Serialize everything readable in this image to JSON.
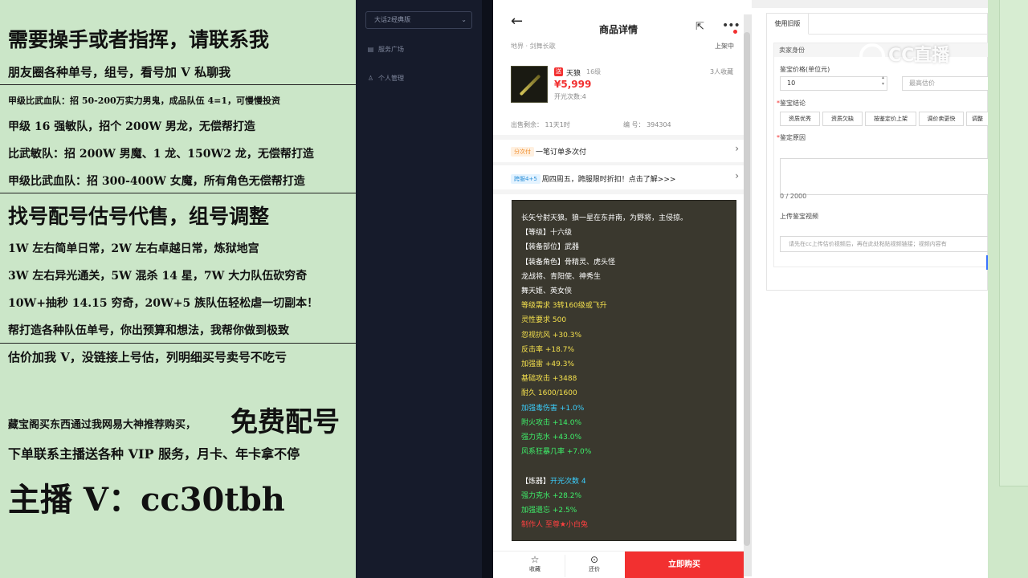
{
  "promo": {
    "lines": [
      "需要操手或者指挥，请联系我",
      "朋友圈各种单号，组号，看号加 V 私聊我",
      "甲级比武血队：招 50-200万实力男鬼，成品队伍 4=1，可慢慢投资",
      "甲级 16 强敏队，招个 200W 男龙，无偿帮打造",
      "比武敏队：招 200W 男魔、1 龙、150W2 龙，无偿帮打造",
      "甲级比武血队：招 300-400W 女魔，所有角色无偿帮打造",
      "找号配号估号代售，组号调整",
      "1W 左右简单日常，2W 左右卓越日常，炼狱地宫",
      "3W 左右异光通关，5W 混杀 14 星，7W 大力队伍砍穷奇",
      "10W+抽秒 14.15 穷奇，20W+5 族队伍轻松虐一切副本！",
      "帮打造各种队伍单号，你出预算和想法，我帮你做到极致",
      "估价加我 V，没链接上号估，列明细买号卖号不吃亏",
      "藏宝阁买东西通过我网易大神推荐购买，",
      "免费配号",
      "下单联系主播送各种 VIP 服务，月卡、年卡拿不停",
      "主播 V：cc30tbh"
    ]
  },
  "nav": {
    "select_label": "大话2经典版",
    "items": [
      "服务广场",
      "个人管理"
    ],
    "icons": [
      "doc-icon",
      "user-icon"
    ]
  },
  "phone": {
    "title": "商品详情",
    "realm": "地界 · 剑舞长歌",
    "status": "上架中",
    "item": {
      "tag": "送",
      "name": "天狼",
      "level": "16级",
      "price": "¥5,999",
      "opens": "开光次数:4",
      "favorites": "3人收藏",
      "remaining": "出售剩余： 11天1时",
      "code": "编 号： 394304"
    },
    "promos": [
      {
        "badge": "分次付",
        "text": "一笔订单多次付",
        "badge_bg": "#fff0e0",
        "badge_fg": "#f08a24"
      },
      {
        "badge": "跨服4+5",
        "text": "周四周五，跨服限时折扣！点击了解>>>",
        "badge_bg": "#e4f3ff",
        "badge_fg": "#2a8fd8"
      }
    ],
    "stats": [
      {
        "text": "长矢兮射天狼。狼一星在东井南，为野将，主侵掠。",
        "color": "#ffffff"
      },
      {
        "text": "【等级】十六级",
        "color": "#ffffff"
      },
      {
        "text": "【装备部位】武器",
        "color": "#ffffff"
      },
      {
        "text": "【装备角色】骨精灵、虎头怪",
        "color": "#ffffff"
      },
      {
        "text": "龙战将、青阳使、神秀生",
        "color": "#ffffff"
      },
      {
        "text": "舞天姬、英女侠",
        "color": "#ffffff"
      },
      {
        "text": "等级需求 3转160级或飞升",
        "color": "#f4e04d"
      },
      {
        "text": "灵性要求 500",
        "color": "#f4e04d"
      },
      {
        "text": "忽视抗风 +30.3%",
        "color": "#f4e04d"
      },
      {
        "text": "反击率 +18.7%",
        "color": "#f4e04d"
      },
      {
        "text": "加强雷 +49.3%",
        "color": "#f4e04d"
      },
      {
        "text": "基础攻击 +3488",
        "color": "#f4e04d"
      },
      {
        "text": "耐久 1600/1600",
        "color": "#f4e04d"
      },
      {
        "text": "加强毒伤害 +1.0%",
        "color": "#3ad0ff"
      },
      {
        "text": "附火攻击 +14.0%",
        "color": "#3ef06a"
      },
      {
        "text": "强力克水 +43.0%",
        "color": "#3ef06a"
      },
      {
        "text": "风系狂暴几率 +7.0%",
        "color": "#3ef06a"
      },
      {
        "text": "",
        "color": "#ffffff"
      },
      {
        "text": "【炼器】开光次数 4",
        "color": "#ffffff",
        "accent": "开光次数 4"
      },
      {
        "text": "强力克水 +28.2%",
        "color": "#3ef06a"
      },
      {
        "text": "加强遗忘 +2.5%",
        "color": "#3ef06a"
      },
      {
        "text": "制作人 至尊★小白兔",
        "color": "#ff4040"
      }
    ],
    "bottom": {
      "fav": "收藏",
      "bargain": "还价",
      "buy": "立即购买"
    }
  },
  "form": {
    "tab": "使用旧版",
    "section": "卖家身份",
    "price_label": "鉴宝价格(单位元)",
    "price_value": "10",
    "price_max_placeholder": "最高估价",
    "result_label": "鉴宝结论",
    "chips": [
      "资质优秀",
      "资质欠缺",
      "按鉴定价上架",
      "调价卖更快",
      "调整"
    ],
    "reason_label": "鉴定原因",
    "reason_count": "0 / 2000",
    "video_label": "上传鉴宝视频",
    "video_placeholder": "请先在cc上传估价视频后，再在此处粘贴视频链接；视频内容有"
  },
  "watermark": {
    "text": "CC直播"
  }
}
